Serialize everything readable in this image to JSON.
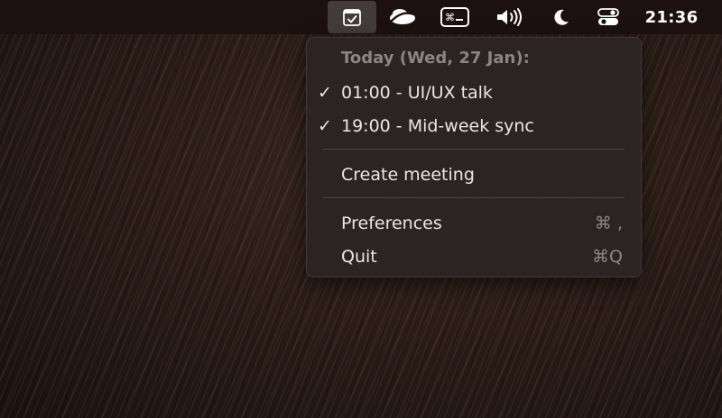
{
  "menubar": {
    "clock": "21:36",
    "icons": [
      "calendar-check-icon",
      "cloud-app-icon",
      "command-key-icon",
      "volume-icon",
      "moon-icon",
      "control-center-icon"
    ]
  },
  "menu": {
    "header": "Today (Wed, 27 Jan):",
    "meetings": [
      {
        "check": "✓",
        "label": "01:00 - UI/UX talk"
      },
      {
        "check": "✓",
        "label": "19:00 - Mid-week sync"
      }
    ],
    "create_label": "Create meeting",
    "preferences_label": "Preferences",
    "preferences_shortcut": "⌘ ,",
    "quit_label": "Quit",
    "quit_shortcut": "⌘Q"
  }
}
